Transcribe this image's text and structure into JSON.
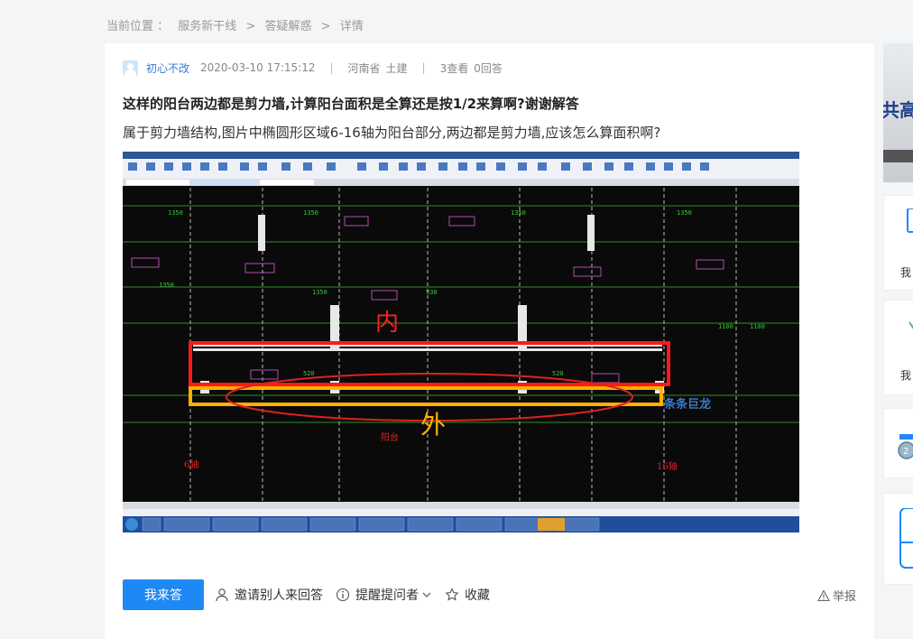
{
  "breadcrumb": {
    "prefix": "当前位置 ：",
    "items": [
      "服务新干线",
      "答疑解惑",
      "详情"
    ],
    "sep": ">"
  },
  "question": {
    "user": "初心不改",
    "datetime": "2020-03-10 17:15:12",
    "location": "河南省",
    "category": "土建",
    "views": "3查看",
    "answers": "0回答",
    "title": "这样的阳台两边都是剪力墙,计算阳台面积是全算还是按1/2来算啊?谢谢解答",
    "description": "属于剪力墙结构,图片中椭圆形区域6-16轴为阳台部分,两边都是剪力墙,应该怎么算面积啊?"
  },
  "image": {
    "label_inner": "内",
    "label_outer": "外",
    "label_balcony": "阳台",
    "axis_left": "6轴",
    "axis_right": "16轴",
    "watermark": "条条巨龙",
    "colors": {
      "rect_inner": "#ff1a1a",
      "rect_outer": "#ffb000",
      "ellipse": "#e02020"
    }
  },
  "actions": {
    "answer": "我来答",
    "invite": "邀请别人来回答",
    "remind": "提醒提问者",
    "favorite": "收藏",
    "report": "举报"
  },
  "sidebar": {
    "labels": [
      "我",
      "我"
    ]
  }
}
